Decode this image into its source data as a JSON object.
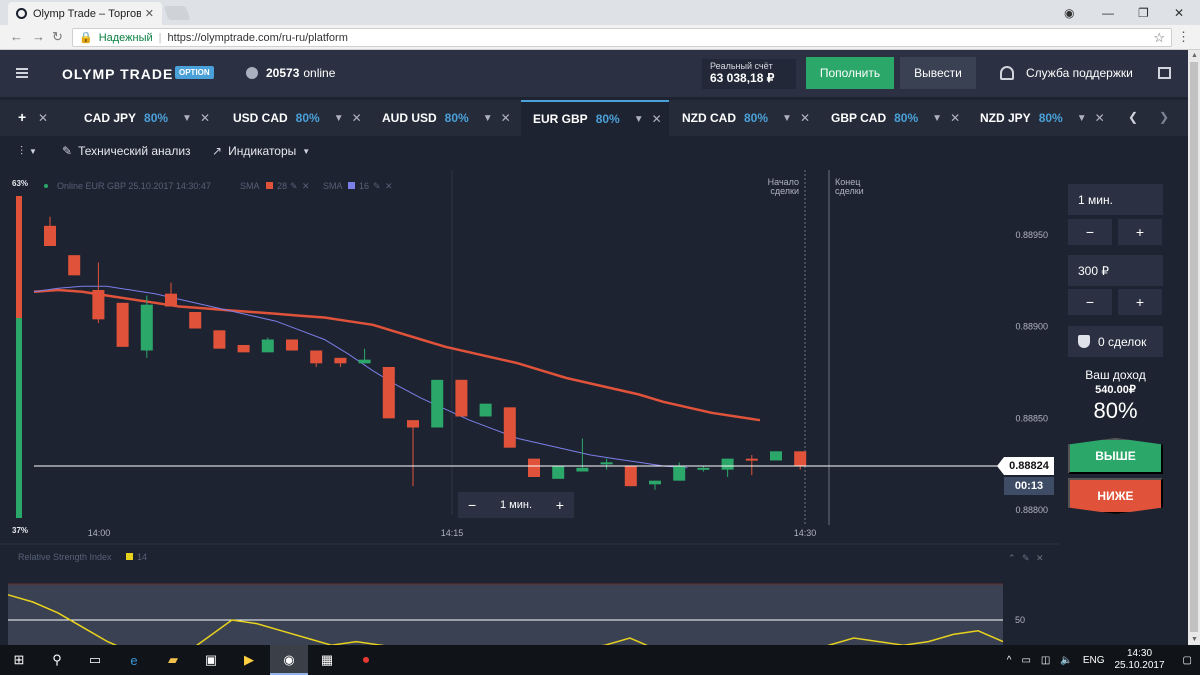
{
  "browser": {
    "tab_title": "Olymp Trade – Торговая",
    "close": "✕",
    "secure_label": "Надежный",
    "url": "https://olymptrade.com/ru-ru/platform",
    "win_account": "◉",
    "win_min": "—",
    "win_max": "❐",
    "win_close": "✕"
  },
  "header": {
    "logo": "OLYMP TRADE",
    "logo_badge": "OPTION",
    "online_count": "20573",
    "online_word": "online",
    "account_label": "Реальный счёт",
    "account_value": "63 038,18 ₽",
    "deposit_label": "Пополнить",
    "withdraw_label": "Вывести",
    "support_label": "Служба поддержки"
  },
  "asset_tabs": [
    {
      "name": "CAD JPY",
      "pct": "80%"
    },
    {
      "name": "USD CAD",
      "pct": "80%"
    },
    {
      "name": "AUD USD",
      "pct": "80%"
    },
    {
      "name": "EUR GBP",
      "pct": "80%",
      "active": true
    },
    {
      "name": "NZD CAD",
      "pct": "80%"
    },
    {
      "name": "GBP CAD",
      "pct": "80%"
    },
    {
      "name": "NZD JPY",
      "pct": "80%"
    }
  ],
  "toolbar": {
    "tech_analysis": "Технический анализ",
    "indicators": "Индикаторы"
  },
  "chart": {
    "sentiment_top": "63%",
    "sentiment_bottom": "37%",
    "info_line": "Online EUR GBP 25.10.2017 14:30:47",
    "sma_label": "SMA",
    "sma1_period": "28",
    "sma2_period": "16",
    "start_label_1": "Начало",
    "start_label_2": "сделки",
    "end_label_1": "Конец",
    "end_label_2": "сделки",
    "current_price": "0.88824",
    "timer": "00:13",
    "timeframe": "1 мин.",
    "colors": {
      "up": "#2ca76a",
      "down": "#e0533a",
      "sma1": "#e0533a",
      "sma2": "#7b7fe8",
      "rsi": "#e8d21e"
    }
  },
  "chart_data": {
    "type": "candlestick",
    "x_ticks": [
      "14:00",
      "14:15",
      "14:30"
    ],
    "y_ticks": [
      "0.88950",
      "0.88900",
      "0.88850",
      "0.88800"
    ],
    "price_range": [
      0.8879,
      0.8899
    ],
    "candles": [
      {
        "o": 0.88955,
        "h": 0.8896,
        "c": 0.88944,
        "l": 0.88944
      },
      {
        "o": 0.88939,
        "h": 0.88939,
        "c": 0.88928,
        "l": 0.88928
      },
      {
        "o": 0.8892,
        "h": 0.88935,
        "c": 0.88904,
        "l": 0.88902
      },
      {
        "o": 0.88913,
        "h": 0.88913,
        "c": 0.88889,
        "l": 0.88889
      },
      {
        "o": 0.88887,
        "h": 0.88917,
        "c": 0.88912,
        "l": 0.88883
      },
      {
        "o": 0.88918,
        "h": 0.88924,
        "c": 0.88911,
        "l": 0.88911
      },
      {
        "o": 0.88908,
        "h": 0.88908,
        "c": 0.88899,
        "l": 0.88899
      },
      {
        "o": 0.88898,
        "h": 0.88898,
        "c": 0.88888,
        "l": 0.88888
      },
      {
        "o": 0.8889,
        "h": 0.8889,
        "c": 0.88886,
        "l": 0.88886
      },
      {
        "o": 0.88886,
        "h": 0.88894,
        "c": 0.88893,
        "l": 0.88886
      },
      {
        "o": 0.88893,
        "h": 0.88893,
        "c": 0.88887,
        "l": 0.88887
      },
      {
        "o": 0.88887,
        "h": 0.88887,
        "c": 0.8888,
        "l": 0.88878
      },
      {
        "o": 0.88883,
        "h": 0.88883,
        "c": 0.8888,
        "l": 0.88878
      },
      {
        "o": 0.8888,
        "h": 0.88888,
        "c": 0.88882,
        "l": 0.8888
      },
      {
        "o": 0.88878,
        "h": 0.88878,
        "c": 0.8885,
        "l": 0.8885
      },
      {
        "o": 0.88849,
        "h": 0.88849,
        "c": 0.88845,
        "l": 0.88813
      },
      {
        "o": 0.88845,
        "h": 0.88871,
        "c": 0.88871,
        "l": 0.88845
      },
      {
        "o": 0.88871,
        "h": 0.88871,
        "c": 0.88851,
        "l": 0.88851
      },
      {
        "o": 0.88851,
        "h": 0.88858,
        "c": 0.88858,
        "l": 0.88851
      },
      {
        "o": 0.88856,
        "h": 0.88856,
        "c": 0.88834,
        "l": 0.88834
      },
      {
        "o": 0.88828,
        "h": 0.88828,
        "c": 0.88818,
        "l": 0.88818
      },
      {
        "o": 0.88817,
        "h": 0.88817,
        "c": 0.88824,
        "l": 0.88817
      },
      {
        "o": 0.88821,
        "h": 0.88839,
        "c": 0.88823,
        "l": 0.88821
      },
      {
        "o": 0.88825,
        "h": 0.88828,
        "c": 0.88826,
        "l": 0.88822
      },
      {
        "o": 0.88824,
        "h": 0.88824,
        "c": 0.88813,
        "l": 0.88813
      },
      {
        "o": 0.88814,
        "h": 0.88816,
        "c": 0.88816,
        "l": 0.88811
      },
      {
        "o": 0.88816,
        "h": 0.88826,
        "c": 0.88824,
        "l": 0.88816
      },
      {
        "o": 0.88823,
        "h": 0.88824,
        "c": 0.88823,
        "l": 0.88821
      },
      {
        "o": 0.88822,
        "h": 0.88828,
        "c": 0.88828,
        "l": 0.88818
      },
      {
        "o": 0.88828,
        "h": 0.8883,
        "c": 0.88827,
        "l": 0.88819
      },
      {
        "o": 0.88827,
        "h": 0.88832,
        "c": 0.88832,
        "l": 0.88827
      },
      {
        "o": 0.88832,
        "h": 0.88832,
        "c": 0.88824,
        "l": 0.88822
      }
    ],
    "sma28": [
      0.88919,
      0.8892,
      0.88919,
      0.88917,
      0.88915,
      0.88913,
      0.88911,
      0.8891,
      0.88909,
      0.88908,
      0.88907,
      0.88906,
      0.88905,
      0.88903,
      0.88901,
      0.88897,
      0.88893,
      0.88889,
      0.88886,
      0.88883,
      0.8888,
      0.88876,
      0.88872,
      0.88869,
      0.88866,
      0.88863,
      0.88859,
      0.88856,
      0.88853,
      0.88851,
      0.88849
    ],
    "sma16": [
      0.88919,
      0.88921,
      0.88922,
      0.88922,
      0.8892,
      0.88918,
      0.88915,
      0.88912,
      0.88909,
      0.88906,
      0.88903,
      0.88898,
      0.88893,
      0.88885,
      0.88876,
      0.88868,
      0.88861,
      0.88855,
      0.88849,
      0.88844,
      0.88839,
      0.88836,
      0.88833,
      0.8883,
      0.88828,
      0.88826,
      0.88824,
      0.88823
    ],
    "indicator_label": "Relative Strength Index",
    "indicator_period": "14",
    "rsi_tick": "50",
    "rsi": [
      57,
      55,
      52,
      48,
      44,
      41,
      42,
      40,
      45,
      50,
      49,
      47,
      45,
      43,
      44,
      43,
      42,
      40,
      41,
      42,
      42,
      41,
      42,
      42,
      43,
      45,
      42,
      40,
      41,
      42,
      40,
      39,
      40,
      43,
      45,
      44,
      43,
      44,
      46,
      47,
      44
    ]
  },
  "trade_panel": {
    "duration": "1 мин.",
    "amount": "300 ₽",
    "minus": "−",
    "plus": "+",
    "deals": "0 сделок",
    "income_label": "Ваш доход",
    "income_value": "540.00₽",
    "income_pct": "80%",
    "up_label": "ВЫШЕ",
    "down_label": "НИЖЕ"
  },
  "taskbar": {
    "lang": "ENG",
    "time": "14:30",
    "date": "25.10.2017"
  }
}
